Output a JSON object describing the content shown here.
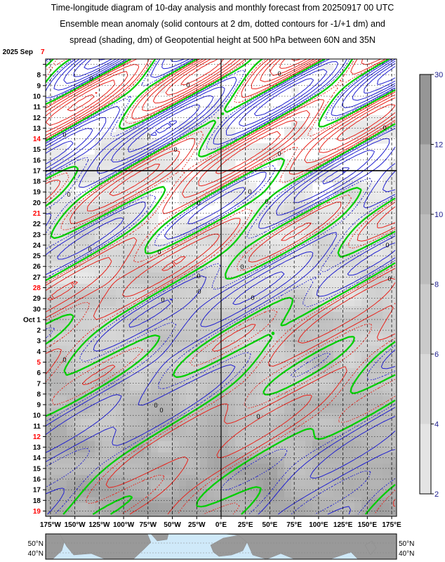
{
  "title_lines": [
    "Time-longitude diagram of 10-day analysis and monthly forecast from 20250917 00 UTC",
    "Ensemble mean anomaly (solid contours at 2 dm, dotted contours for -1/+1 dm) and",
    "spread (shading, dm) of Geopotential height at 500 hPa between 60N and 35N"
  ],
  "chart_data": {
    "type": "heatmap",
    "x_ticks": [
      "175°W",
      "150°W",
      "125°W",
      "100°W",
      "75°W",
      "50°W",
      "25°W",
      "0°E",
      "25°E",
      "50°E",
      "75°E",
      "100°E",
      "125°E",
      "150°E",
      "175°E"
    ],
    "x_range": [
      -180,
      180
    ],
    "y_start_label": "2025 Sep",
    "y_ticks": [
      {
        "label": "7",
        "color": "#ff0000"
      },
      {
        "label": "8",
        "color": "#000000"
      },
      {
        "label": "9",
        "color": "#000000"
      },
      {
        "label": "10",
        "color": "#000000"
      },
      {
        "label": "11",
        "color": "#000000"
      },
      {
        "label": "12",
        "color": "#000000"
      },
      {
        "label": "13",
        "color": "#000000"
      },
      {
        "label": "14",
        "color": "#ff0000"
      },
      {
        "label": "15",
        "color": "#000000"
      },
      {
        "label": "16",
        "color": "#000000"
      },
      {
        "label": "17",
        "color": "#000000"
      },
      {
        "label": "18",
        "color": "#000000"
      },
      {
        "label": "19",
        "color": "#000000"
      },
      {
        "label": "20",
        "color": "#000000"
      },
      {
        "label": "21",
        "color": "#ff0000"
      },
      {
        "label": "22",
        "color": "#000000"
      },
      {
        "label": "23",
        "color": "#000000"
      },
      {
        "label": "24",
        "color": "#000000"
      },
      {
        "label": "25",
        "color": "#000000"
      },
      {
        "label": "26",
        "color": "#000000"
      },
      {
        "label": "27",
        "color": "#000000"
      },
      {
        "label": "28",
        "color": "#ff0000"
      },
      {
        "label": "29",
        "color": "#000000"
      },
      {
        "label": "30",
        "color": "#000000"
      },
      {
        "label": "Oct 1",
        "color": "#000000"
      },
      {
        "label": "2",
        "color": "#000000"
      },
      {
        "label": "3",
        "color": "#000000"
      },
      {
        "label": "4",
        "color": "#000000"
      },
      {
        "label": "5",
        "color": "#ff0000"
      },
      {
        "label": "6",
        "color": "#000000"
      },
      {
        "label": "7",
        "color": "#000000"
      },
      {
        "label": "8",
        "color": "#000000"
      },
      {
        "label": "9",
        "color": "#000000"
      },
      {
        "label": "10",
        "color": "#000000"
      },
      {
        "label": "11",
        "color": "#000000"
      },
      {
        "label": "12",
        "color": "#ff0000"
      },
      {
        "label": "13",
        "color": "#000000"
      },
      {
        "label": "14",
        "color": "#000000"
      },
      {
        "label": "15",
        "color": "#000000"
      },
      {
        "label": "16",
        "color": "#000000"
      },
      {
        "label": "17",
        "color": "#000000"
      },
      {
        "label": "18",
        "color": "#000000"
      },
      {
        "label": "19",
        "color": "#ff0000"
      }
    ],
    "analysis_end_label": "17",
    "colorbar": {
      "ticks": [
        "2",
        "4",
        "6",
        "8",
        "10",
        "12",
        "30"
      ],
      "range": [
        2,
        30
      ],
      "text_color": "#1a1a8c"
    },
    "map_lat_labels": [
      "50°N",
      "40°N"
    ],
    "colors": {
      "positive": "#e8241c",
      "negative": "#2020d0",
      "zero": "#00d000",
      "label": "#ff0000"
    },
    "zero_contour_label": "0"
  }
}
